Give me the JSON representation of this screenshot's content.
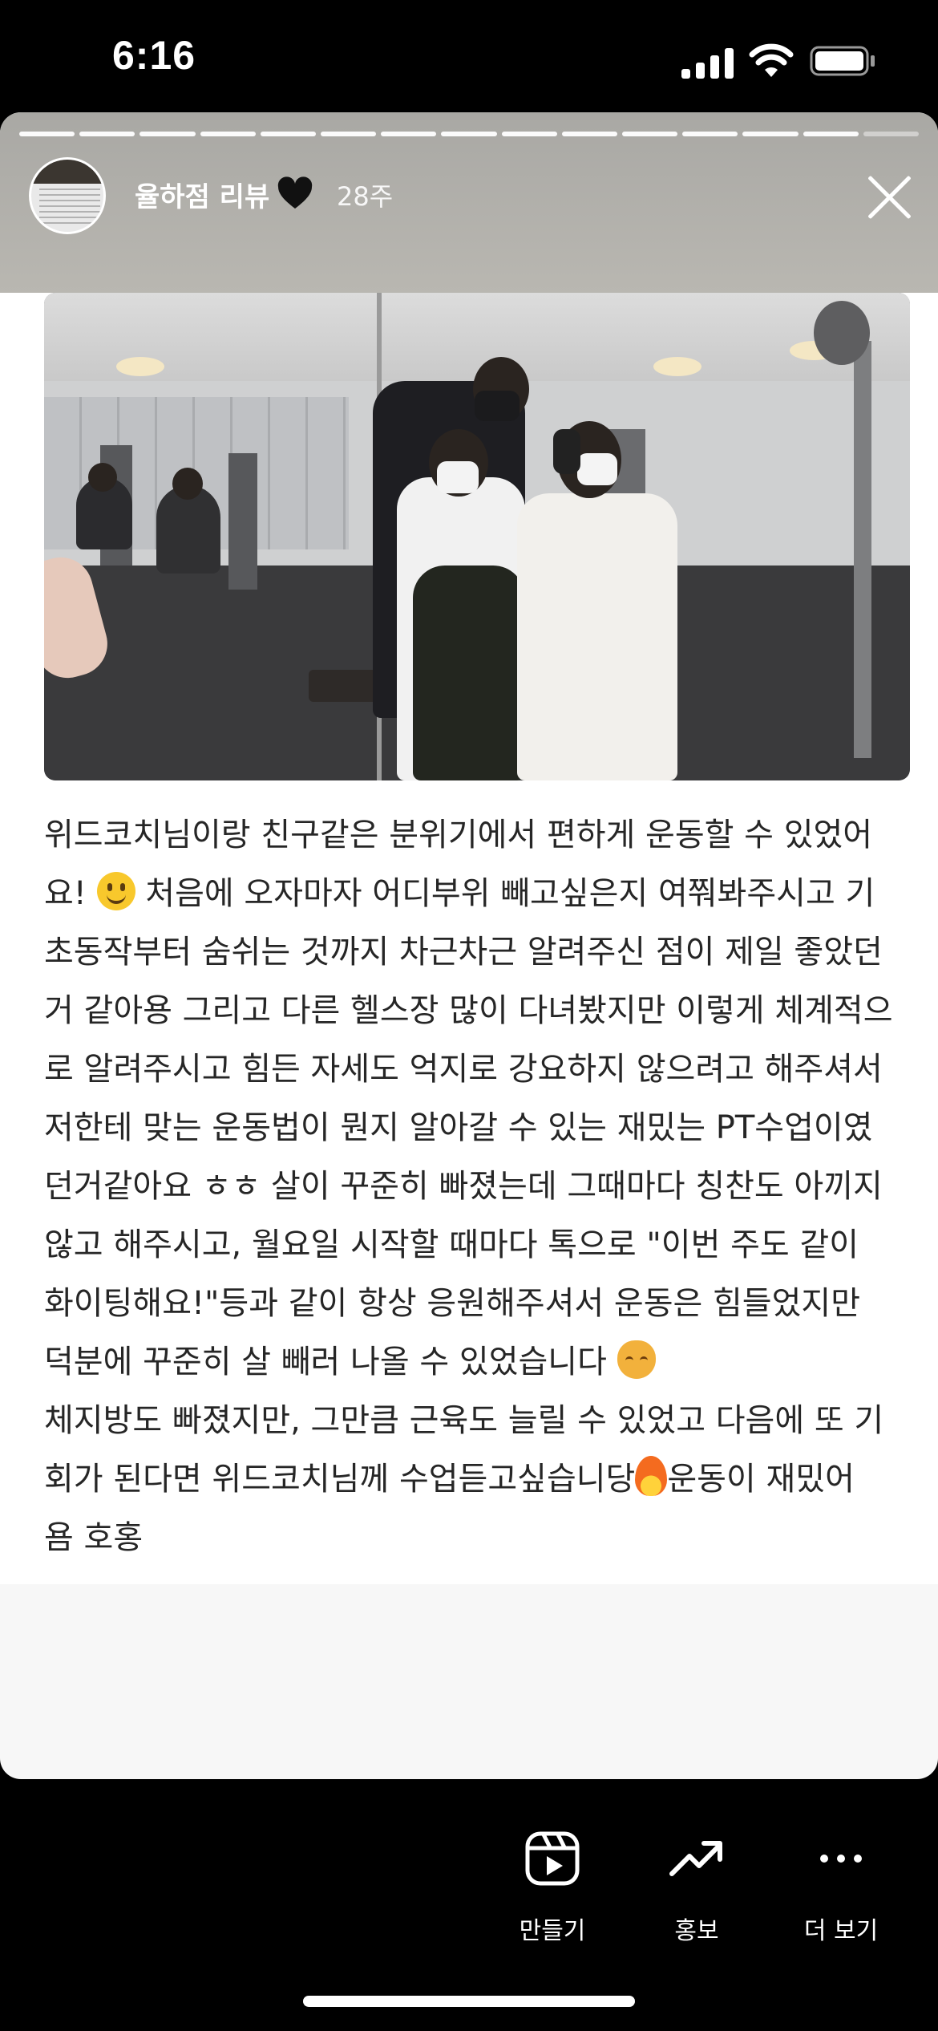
{
  "status_bar": {
    "time": "6:16",
    "icons": [
      "cellular-signal-icon",
      "wifi-icon",
      "battery-icon"
    ]
  },
  "story": {
    "account_name": "율하점 리뷰",
    "name_emoji": "black-heart-icon",
    "time_ago": "28주",
    "progress": {
      "segments": 15,
      "completed": 14
    },
    "image": "gym-mirror-selfie-photo",
    "review_lines": [
      "위드코치님이랑 친구같은 분위기에서 편하게 운동할 수 있었어",
      "요!",
      "처음에 오자마자 어디부위 빼고싶은지 여쭤봐주시고 기",
      "초동작부터 숨쉬는 것까지 차근차근 알려주신 점이 제일 좋았던",
      "거 같아용 그리고 다른 헬스장 많이 다녀봤지만 이렇게 체계적으",
      "로 알려주시고 힘든 자세도 억지로 강요하지 않으려고 해주셔서",
      "저한테 맞는 운동법이 뭔지 알아갈 수 있는 재밌는 PT수업이였",
      "던거같아요 ㅎㅎ 살이 꾸준히 빠졌는데 그때마다 칭찬도 아끼지",
      "않고 해주시고, 월요일 시작할 때마다 톡으로 \"이번 주도 같이",
      "화이팅해요!\"등과 같이 항상 응원해주셔서 운동은 힘들었지만",
      "덕분에 꾸준히 살 빼러 나올 수 있었습니다",
      "체지방도 빠졌지만, 그만큼 근육도 늘릴 수 있었고 다음에 또 기",
      "회가 된다면 위드코치님께 수업듣고싶습니당",
      "운동이 재밌어",
      "욤 호홍"
    ]
  },
  "actions": {
    "create_label": "만들기",
    "promote_label": "홍보",
    "more_label": "더 보기"
  },
  "colors": {
    "header_bg": "#b0afa9",
    "card_bg": "#ffffff",
    "text": "#262626"
  }
}
